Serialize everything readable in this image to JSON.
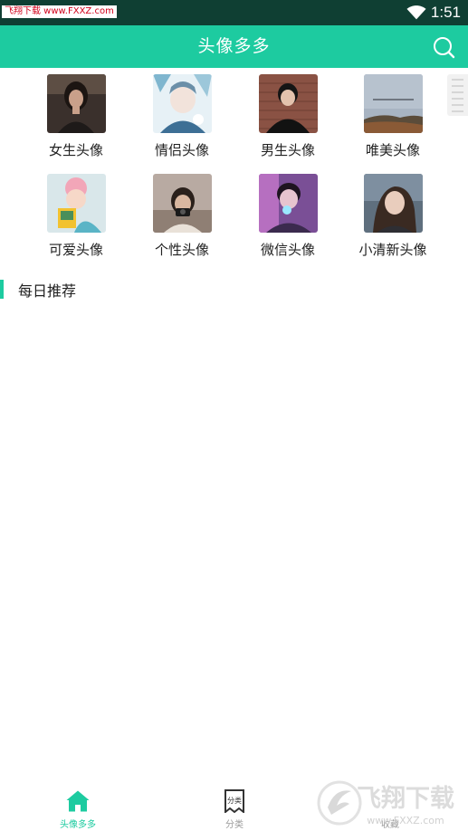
{
  "status_bar": {
    "watermark": "飞翔下载 www.FXXZ.com",
    "time": "1:51"
  },
  "header": {
    "title": "头像多多"
  },
  "categories": [
    {
      "label": "女生头像",
      "thumb": "portrait-woman-dark"
    },
    {
      "label": "情侣头像",
      "thumb": "anime-couple"
    },
    {
      "label": "男生头像",
      "thumb": "portrait-man-brick"
    },
    {
      "label": "唯美头像",
      "thumb": "landscape-sky"
    },
    {
      "label": "可爱头像",
      "thumb": "cute-girl"
    },
    {
      "label": "个性头像",
      "thumb": "girl-camera"
    },
    {
      "label": "微信头像",
      "thumb": "boy-neon"
    },
    {
      "label": "小清新头像",
      "thumb": "girl-outdoor"
    }
  ],
  "section": {
    "title": "每日推荐"
  },
  "bottom_nav": {
    "items": [
      {
        "label": "头像多多",
        "icon": "home-icon",
        "active": true
      },
      {
        "label": "分类",
        "icon": "category-icon",
        "active": false
      },
      {
        "label": "收藏",
        "icon": "favorite-icon",
        "active": false
      }
    ],
    "category_icon_text": "分类"
  },
  "brand_logo": {
    "text": "飞翔下载",
    "url": "www.FXXZ.com"
  },
  "colors": {
    "accent": "#1dcba0",
    "status_bar": "#0f3f33",
    "text": "#222222",
    "inactive": "#9a9a9a"
  }
}
